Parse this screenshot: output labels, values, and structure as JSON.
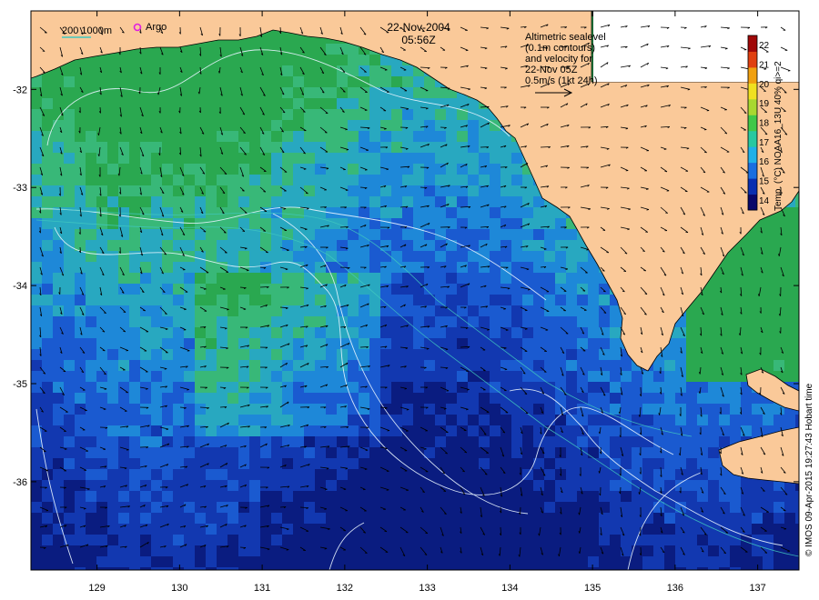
{
  "header": {
    "date": "22-Nov-2004",
    "time": "05:56Z"
  },
  "legend": {
    "depth_label": "200  1000m",
    "argo_label": "Argo",
    "depth_line_color": "#40c8c0",
    "argo_marker_color": "#e020e0"
  },
  "altimetry_note": {
    "lines": [
      "Altimetric sealevel",
      "(0.1m contours)",
      "and velocity for",
      "22-Nov 05Z",
      "0.5m/s (1kt 24h)"
    ]
  },
  "colorbar": {
    "title": "Temp. (°C) NOAA16_13U 40% qi>=2",
    "ticks": [
      "14",
      "15",
      "16",
      "17",
      "18",
      "19",
      "20",
      "21",
      "22"
    ],
    "min": 13.5,
    "max": 22.5,
    "colors": [
      "#08086a",
      "#0a2fb0",
      "#1a6ee0",
      "#20b0e8",
      "#28c8a0",
      "#40c848",
      "#a8d830",
      "#f0e020",
      "#f0a010",
      "#e04010",
      "#a00808"
    ]
  },
  "axes": {
    "lon_ticks": [
      "129",
      "130",
      "131",
      "132",
      "133",
      "134",
      "135",
      "136",
      "137"
    ],
    "lat_ticks": [
      "-32",
      "-33",
      "-34",
      "-35",
      "-36"
    ],
    "lon_range": [
      128.2,
      137.5
    ],
    "lat_range": [
      -31.2,
      -36.9
    ]
  },
  "credit": "© IMOS 09-Apr-2015 19:27:43 Hobart time",
  "colors": {
    "land": "#fac999",
    "contour": "#e8f4ff"
  }
}
